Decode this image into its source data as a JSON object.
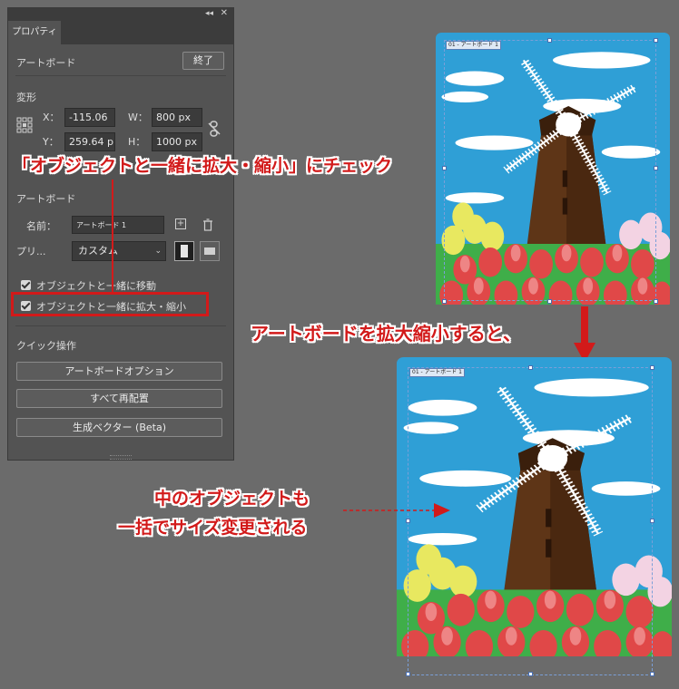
{
  "panel": {
    "tab": "プロパティ",
    "section_artboard": "アートボード",
    "done_button": "終了",
    "transform_title": "変形",
    "x_label": "X：",
    "x_value": "-115.06",
    "y_label": "Y：",
    "y_value": "259.64 p",
    "w_label": "W：",
    "w_value": "800 px",
    "h_label": "H：",
    "h_value": "1000 px",
    "artboard_title": "アートボード",
    "name_label": "名前：",
    "name_value": "アートボード 1",
    "preset_label": "プリ...",
    "preset_value": "カスタム",
    "move_with_objects": "オブジェクトと一緒に移動",
    "scale_with_objects": "オブジェクトと一緒に拡大・縮小",
    "quick_actions": "クイック操作",
    "btn_artboard_options": "アートボードオプション",
    "btn_rearrange_all": "すべて再配置",
    "btn_generative_vector": "生成ベクター (Beta)"
  },
  "annotations": {
    "check_note": "「オブジェクトと一緒に拡大・縮小」にチェック",
    "resize_note": "アートボードを拡大縮小すると、",
    "inner_line1": "中のオブジェクトも",
    "inner_line2": "一括でサイズ変更される"
  },
  "artboard_label": "01 - アートボード 1",
  "colors": {
    "panel_bg": "#535353",
    "accent_red": "#d21a1a",
    "sky": "#2f9fd6"
  }
}
